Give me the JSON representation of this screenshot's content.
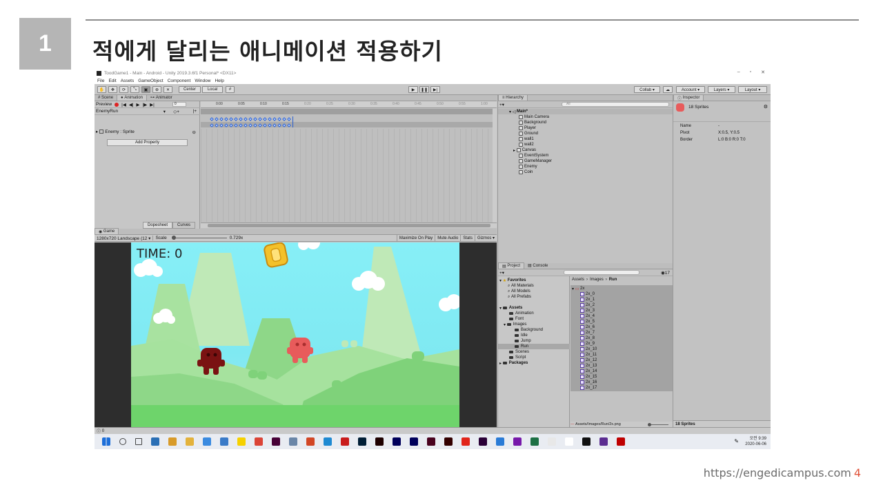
{
  "slide": {
    "number": "1",
    "title": "적에게 달리는 애니메이션 적용하기",
    "footer_url": "https://engedicampus.com",
    "footer_page": "4"
  },
  "window": {
    "title": "ToodGame1 - Main - Android - Unity 2019.3.6f1 Personal* <DX11>",
    "menus": [
      "File",
      "Edit",
      "Assets",
      "GameObject",
      "Component",
      "Window",
      "Help"
    ]
  },
  "toolbar": {
    "center_label": "Center",
    "local_label": "Local",
    "collab_label": "Collab ▾",
    "account_label": "Account ▾",
    "layers_label": "Layers ▾",
    "layout_label": "Layout ▾"
  },
  "animation_panel": {
    "tabs": [
      "Scene",
      "Animation",
      "Animator"
    ],
    "active_tab": "Animation",
    "preview_label": "Preview",
    "frame_value": "0",
    "clip_name": "EnemyRun",
    "property": "Enemy : Sprite",
    "add_property_label": "Add Property",
    "dopesheet_label": "Dopesheet",
    "curves_label": "Curves",
    "ruler_ticks": [
      "0:00",
      "0:05",
      "0:10",
      "0:15",
      "0:20",
      "0:25",
      "0:30",
      "0:35",
      "0:40",
      "0:45",
      "0:50",
      "0:55",
      "1:00",
      "1:05"
    ]
  },
  "game_panel": {
    "tab": "Game",
    "resolution": "1280x720 Landscape (12 ▾",
    "scale_label": "Scale",
    "scale_value": "0.729x",
    "buttons": [
      "Maximize On Play",
      "Mute Audio",
      "Stats",
      "Gizmos ▾"
    ],
    "time_text": "TIME: 0"
  },
  "hierarchy": {
    "tab": "Hierarchy",
    "search_placeholder": "All",
    "root": "Main*",
    "items": [
      "Main Camera",
      "Background",
      "Player",
      "Ground",
      "wall1",
      "wall2",
      "Canvas",
      "EventSystem",
      "GameManager",
      "Enemy",
      "Coin"
    ]
  },
  "project": {
    "tabs": [
      "Project",
      "Console"
    ],
    "hidden_count": "17",
    "favorites_label": "Favorites",
    "favorites": [
      "All Materials",
      "All Models",
      "All Prefabs"
    ],
    "assets_label": "Assets",
    "assets": [
      "Animation",
      "Font",
      "Images",
      "Background",
      "Idle",
      "Jump",
      "Run",
      "Scenes",
      "Script"
    ],
    "packages_label": "Packages",
    "breadcrumb": [
      "Assets",
      "Images",
      "Run"
    ],
    "group": "2x",
    "sprites": [
      "2x_0",
      "2x_1",
      "2x_2",
      "2x_3",
      "2x_4",
      "2x_5",
      "2x_6",
      "2x_7",
      "2x_8",
      "2x_9",
      "2x_10",
      "2x_11",
      "2x_12",
      "2x_13",
      "2x_14",
      "2x_15",
      "2x_16",
      "2x_17"
    ],
    "footer_path": "Assets/Images/Run/2x.png"
  },
  "inspector": {
    "tab": "Inspector",
    "header": "18 Sprites",
    "rows": [
      {
        "k": "Name",
        "v": "-"
      },
      {
        "k": "Pivot",
        "v": "X:0.5, Y:0.5"
      },
      {
        "k": "Border",
        "v": "L:0 B:0 R:0 T:0"
      }
    ],
    "footer": "18 Sprites"
  },
  "status": {
    "text": "0"
  },
  "taskbar": {
    "clock_ampm": "오전 9:39",
    "clock_date": "2020-06-06",
    "icon_names": [
      "windows-icon",
      "search-icon",
      "taskview-icon",
      "mail-icon",
      "paint-icon",
      "explorer-icon",
      "ie-icon",
      "calc-icon",
      "kakao-icon",
      "chrome-icon",
      "xd-icon",
      "app-icon",
      "powerpoint-icon",
      "vscode-icon",
      "record-icon",
      "photoshop-icon",
      "animate-icon",
      "audition-icon",
      "aftereffects-icon",
      "indesign-icon",
      "illustrator-icon",
      "acrobat-icon",
      "premiere-icon",
      "xmind-icon",
      "onenote-icon",
      "excel-icon",
      "drive-icon",
      "github-icon",
      "unity-icon",
      "visualstudio-icon",
      "filezilla-icon"
    ],
    "icon_colors": [
      "#1e6fd9",
      "#444",
      "#444",
      "#2a6fb5",
      "#d89b2a",
      "#e3b23c",
      "#3b8be0",
      "#3a7bc8",
      "#f6d100",
      "#db4437",
      "#470137",
      "#6a86a8",
      "#d24726",
      "#1f8ad2",
      "#c91d1d",
      "#001e36",
      "#1e0000",
      "#00005b",
      "#00005b",
      "#49021f",
      "#330000",
      "#e1251b",
      "#2a0037",
      "#2a7bd6",
      "#7719aa",
      "#1d7044",
      "#e8e8e8",
      "#fff",
      "#111",
      "#5c2d91",
      "#bf0000"
    ]
  },
  "colors": {
    "slide_badge": "#b5b5b5",
    "footer_page": "#e0533a",
    "enemy_dark": "#7a1212",
    "enemy_light": "#e85b5b",
    "coin": "#f3c12a",
    "grass": "#6ed46b"
  }
}
